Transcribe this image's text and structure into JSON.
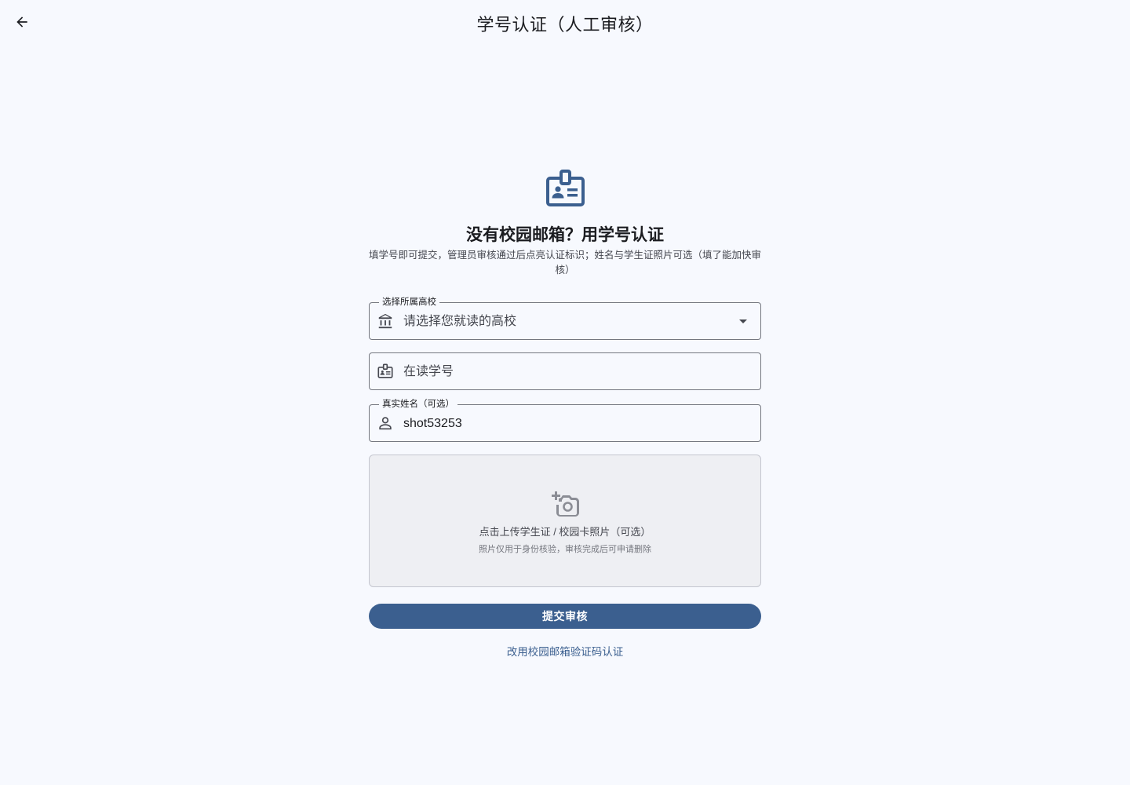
{
  "appbar": {
    "title": "学号认证（人工审核）",
    "back_icon": "arrow-back-icon"
  },
  "hero": {
    "icon": "badge-icon",
    "headline": "没有校园邮箱？用学号认证",
    "description": "填学号即可提交，管理员审核通过后点亮认证标识；姓名与学生证照片可选（填了能加快审核）"
  },
  "form": {
    "school": {
      "label": "选择所属高校",
      "placeholder": "请选择您就读的高校",
      "icon": "institution-icon",
      "trailing_icon": "dropdown-arrow-icon"
    },
    "student_id": {
      "placeholder": "在读学号",
      "icon": "badge-icon"
    },
    "real_name": {
      "label": "真实姓名（可选）",
      "value": "shot53253",
      "icon": "person-icon"
    }
  },
  "upload": {
    "icon": "add-photo-icon",
    "title": "点击上传学生证 / 校园卡照片（可选）",
    "subtitle": "照片仅用于身份核验，审核完成后可申请删除"
  },
  "actions": {
    "submit_label": "提交审核",
    "alt_link_label": "改用校园邮箱验证码认证"
  },
  "colors": {
    "primary": "#3b5f8f",
    "background": "#f7f9fe",
    "outline": "#74777f",
    "upload_bg": "#eeeff3"
  }
}
